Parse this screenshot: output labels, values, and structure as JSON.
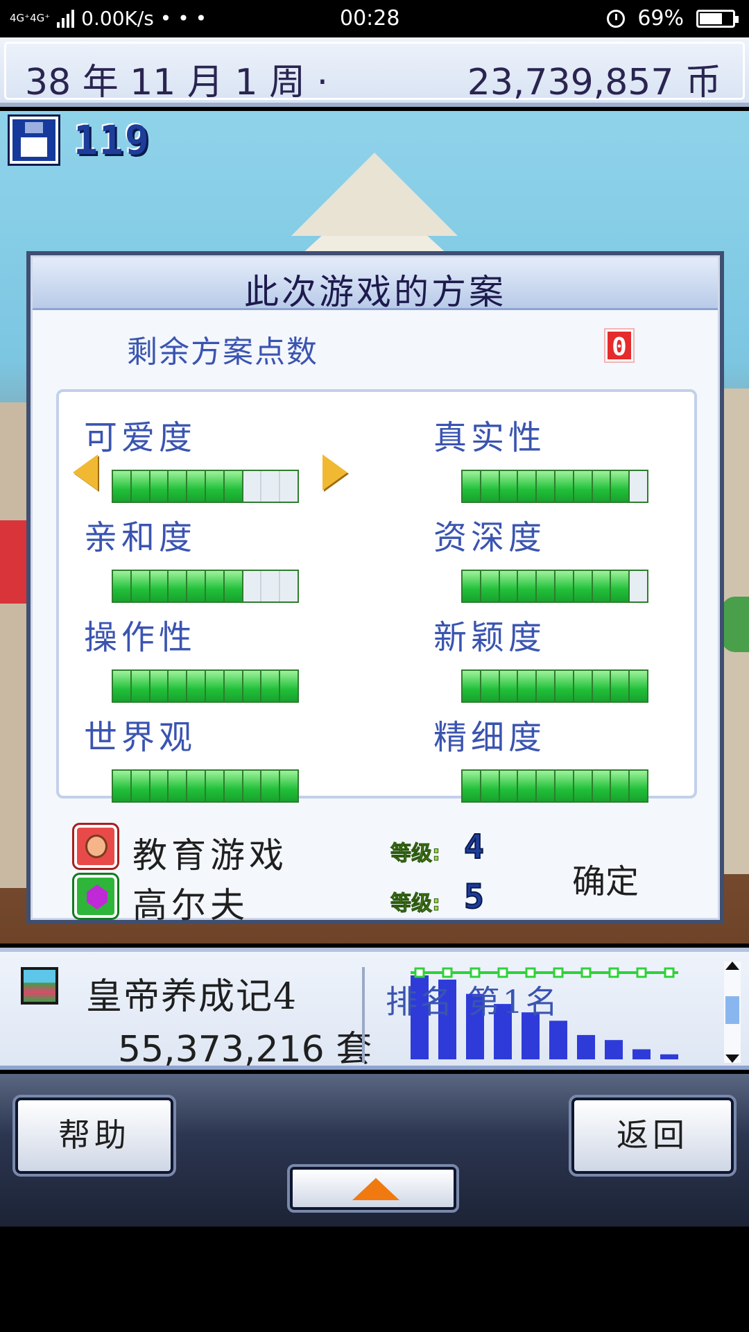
{
  "status_bar": {
    "network": "4G⁺4G⁺",
    "speed": "0.00K/s • • •",
    "time": "00:28",
    "battery": "69%"
  },
  "top_bar": {
    "date": "38 年 11 月 1 周 ·",
    "money": "23,739,857 币"
  },
  "save": {
    "icon": "floppy-disk-icon",
    "count": "119"
  },
  "dialog": {
    "title": "此次游戏的方案",
    "remaining_label": "剩余方案点数",
    "remaining_value": "0",
    "stats": [
      {
        "name": "可爱度",
        "level": 7,
        "max": 10,
        "selected": true
      },
      {
        "name": "真实性",
        "level": 9,
        "max": 10
      },
      {
        "name": "亲和度",
        "level": 7,
        "max": 10
      },
      {
        "name": "资深度",
        "level": 9,
        "max": 10
      },
      {
        "name": "操作性",
        "level": 10,
        "max": 10
      },
      {
        "name": "新颖度",
        "level": 10,
        "max": 10
      },
      {
        "name": "世界观",
        "level": 10,
        "max": 10
      },
      {
        "name": "精细度",
        "level": 10,
        "max": 10
      }
    ],
    "genres": [
      {
        "name": "教育游戏",
        "level_label": "等级:",
        "level": "4",
        "icon": "face-icon",
        "color": "#e84a4a"
      },
      {
        "name": "高尔夫",
        "level_label": "等级:",
        "level": "5",
        "icon": "gem-icon",
        "color": "#2fb53a"
      }
    ],
    "confirm_label": "确定"
  },
  "game_info": {
    "name": "皇帝养成记4",
    "sales": "55,373,216 套",
    "rank_label": "排名 第1名"
  },
  "chart_data": {
    "type": "bar",
    "values": [
      10,
      9.5,
      7.8,
      6.6,
      5.6,
      4.6,
      2.9,
      2.3,
      1.2,
      0.6
    ],
    "highlight_color": "#2e3bd9"
  },
  "nav": {
    "help_label": "帮助",
    "back_label": "返回",
    "expand_icon": "up-arrow-icon"
  },
  "colors": {
    "dialog_text": "#3a54b0",
    "bar_on": "#22c03a",
    "arrow": "#f1b932",
    "remaining_badge": "#e52b2b"
  }
}
